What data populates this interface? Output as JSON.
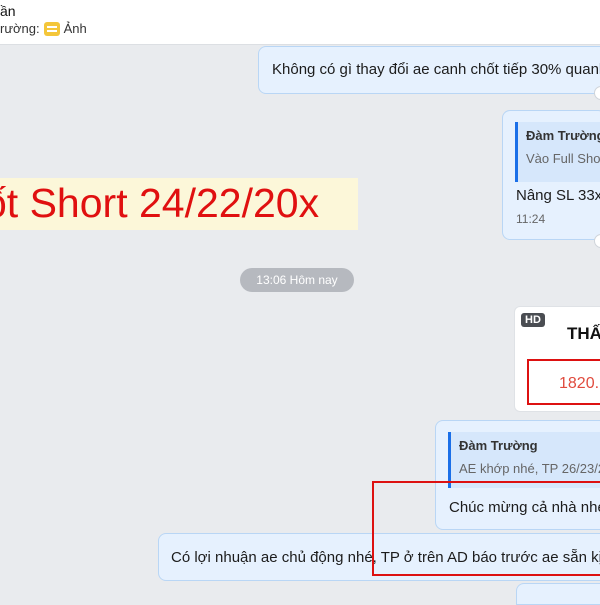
{
  "header": {
    "name": "ần",
    "sub_prefix": "rường:",
    "sub_icon": "image-icon",
    "sub_text": "Ảnh"
  },
  "messages": {
    "m1": {
      "text": "Không có gì thay đổi ae canh chốt tiếp 30% quanh"
    },
    "m2": {
      "reply_name": "Đàm Trường",
      "reply_text": "Vào Full Shor",
      "text": "Nâng SL 33x",
      "time": "11:24"
    },
    "big_text": "ốt Short 24/22/20x",
    "date_separator": "13:06 Hôm nay",
    "hd_card": {
      "tag": "HD",
      "title": "THẤ",
      "value": "1820."
    },
    "m3": {
      "reply_name": "Đàm Trường",
      "reply_text": "AE khớp nhé, TP 26/23/2",
      "text": "Chúc mừng cả nhà nhé"
    },
    "m4": {
      "text": "Có lợi nhuận ae chủ động nhé, TP ở trên AD báo trước ae sẵn kịch"
    }
  },
  "colors": {
    "accent": "#1a6fe8",
    "bubble": "#e6f1fe",
    "highlight_red": "#dd1111",
    "background": "#e9ebee"
  }
}
